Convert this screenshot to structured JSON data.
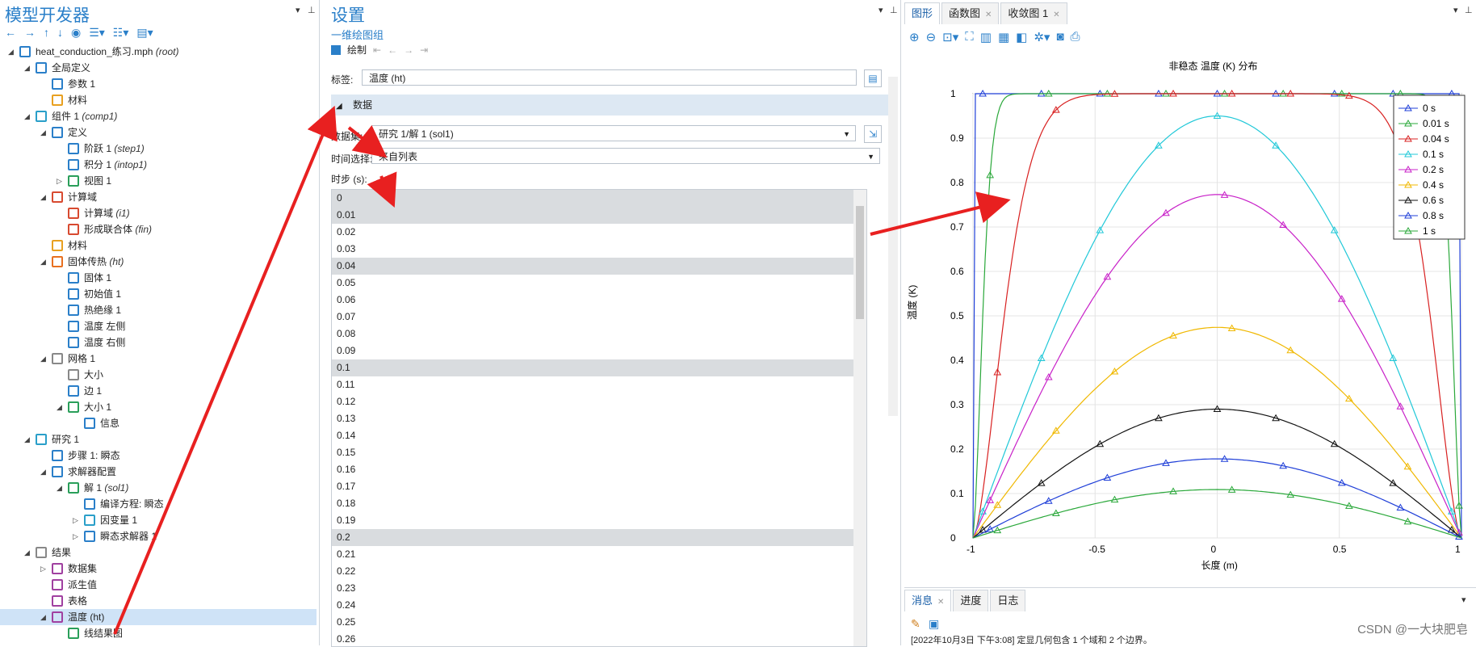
{
  "left": {
    "title": "模型开发器",
    "tree": [
      {
        "label": "heat_conduction_练习.mph",
        "tag": "(root)",
        "indent": 0,
        "toggle": "◢",
        "icon": "#2a7fc9"
      },
      {
        "label": "全局定义",
        "tag": "",
        "indent": 1,
        "toggle": "◢",
        "icon": "#2a7fc9"
      },
      {
        "label": "参数 1",
        "tag": "",
        "indent": 2,
        "toggle": "",
        "icon": "#2a7fc9"
      },
      {
        "label": "材料",
        "tag": "",
        "indent": 2,
        "toggle": "",
        "icon": "#e8a020"
      },
      {
        "label": "组件 1",
        "tag": "(comp1)",
        "indent": 1,
        "toggle": "◢",
        "icon": "#2a9fc9"
      },
      {
        "label": "定义",
        "tag": "",
        "indent": 2,
        "toggle": "◢",
        "icon": "#2a7fc9"
      },
      {
        "label": "阶跃 1",
        "tag": "(step1)",
        "indent": 3,
        "toggle": "",
        "icon": "#2a7fc9"
      },
      {
        "label": "积分 1",
        "tag": "(intop1)",
        "indent": 3,
        "toggle": "",
        "icon": "#2a7fc9"
      },
      {
        "label": "视图 1",
        "tag": "",
        "indent": 3,
        "toggle": "▷",
        "icon": "#2a9f5a"
      },
      {
        "label": "计算域",
        "tag": "",
        "indent": 2,
        "toggle": "◢",
        "icon": "#d84a30"
      },
      {
        "label": "计算域",
        "tag": "(i1)",
        "indent": 3,
        "toggle": "",
        "icon": "#d84a30"
      },
      {
        "label": "形成联合体",
        "tag": "(fin)",
        "indent": 3,
        "toggle": "",
        "icon": "#d84a30"
      },
      {
        "label": "材料",
        "tag": "",
        "indent": 2,
        "toggle": "",
        "icon": "#e8a020"
      },
      {
        "label": "固体传热",
        "tag": "(ht)",
        "indent": 2,
        "toggle": "◢",
        "icon": "#e87020"
      },
      {
        "label": "固体 1",
        "tag": "",
        "indent": 3,
        "toggle": "",
        "icon": "#2a7fc9"
      },
      {
        "label": "初始值 1",
        "tag": "",
        "indent": 3,
        "toggle": "",
        "icon": "#2a7fc9"
      },
      {
        "label": "热绝缘 1",
        "tag": "",
        "indent": 3,
        "toggle": "",
        "icon": "#2a7fc9"
      },
      {
        "label": "温度 左侧",
        "tag": "",
        "indent": 3,
        "toggle": "",
        "icon": "#2a7fc9"
      },
      {
        "label": "温度 右侧",
        "tag": "",
        "indent": 3,
        "toggle": "",
        "icon": "#2a7fc9"
      },
      {
        "label": "网格 1",
        "tag": "",
        "indent": 2,
        "toggle": "◢",
        "icon": "#888888"
      },
      {
        "label": "大小",
        "tag": "",
        "indent": 3,
        "toggle": "",
        "icon": "#888888"
      },
      {
        "label": "边 1",
        "tag": "",
        "indent": 3,
        "toggle": "",
        "icon": "#2a7fc9"
      },
      {
        "label": "大小 1",
        "tag": "",
        "indent": 3,
        "toggle": "◢",
        "icon": "#2a9f5a"
      },
      {
        "label": "信息",
        "tag": "",
        "indent": 4,
        "toggle": "",
        "icon": "#2a7fc9"
      },
      {
        "label": "研究 1",
        "tag": "",
        "indent": 1,
        "toggle": "◢",
        "icon": "#2a9fc9"
      },
      {
        "label": "步骤 1: 瞬态",
        "tag": "",
        "indent": 2,
        "toggle": "",
        "icon": "#2a7fc9"
      },
      {
        "label": "求解器配置",
        "tag": "",
        "indent": 2,
        "toggle": "◢",
        "icon": "#2a7fc9"
      },
      {
        "label": "解 1",
        "tag": "(sol1)",
        "indent": 3,
        "toggle": "◢",
        "icon": "#2a9f5a"
      },
      {
        "label": "编译方程: 瞬态",
        "tag": "",
        "indent": 4,
        "toggle": "",
        "icon": "#2a7fc9"
      },
      {
        "label": "因变量 1",
        "tag": "",
        "indent": 4,
        "toggle": "▷",
        "icon": "#2a9fc9"
      },
      {
        "label": "瞬态求解器 1",
        "tag": "",
        "indent": 4,
        "toggle": "▷",
        "icon": "#2a7fc9"
      },
      {
        "label": "结果",
        "tag": "",
        "indent": 1,
        "toggle": "◢",
        "icon": "#888888"
      },
      {
        "label": "数据集",
        "tag": "",
        "indent": 2,
        "toggle": "▷",
        "icon": "#a040a0"
      },
      {
        "label": "派生值",
        "tag": "",
        "indent": 2,
        "toggle": "",
        "icon": "#a040a0"
      },
      {
        "label": "表格",
        "tag": "",
        "indent": 2,
        "toggle": "",
        "icon": "#a040a0"
      },
      {
        "label": "温度 (ht)",
        "tag": "",
        "indent": 2,
        "toggle": "◢",
        "icon": "#a040a0",
        "selected": true
      },
      {
        "label": "线结果图",
        "tag": "",
        "indent": 3,
        "toggle": "",
        "icon": "#2a9f5a"
      }
    ]
  },
  "mid": {
    "title": "设置",
    "subtitle": "一维绘图组",
    "plot_label": "绘制",
    "label_caption": "标签:",
    "label_value": "温度 (ht)",
    "section": "数据",
    "dataset_caption": "数据集:",
    "dataset_value": "研究 1/解 1 (sol1)",
    "time_caption": "时间选择:",
    "time_value": "来自列表",
    "timestep_caption": "时步 (s):",
    "timesteps": [
      "0",
      "0.01",
      "0.02",
      "0.03",
      "0.04",
      "0.05",
      "0.06",
      "0.07",
      "0.08",
      "0.09",
      "0.1",
      "0.11",
      "0.12",
      "0.13",
      "0.14",
      "0.15",
      "0.16",
      "0.17",
      "0.18",
      "0.19",
      "0.2",
      "0.21",
      "0.22",
      "0.23",
      "0.24",
      "0.25",
      "0.26"
    ],
    "highlighted": [
      "0",
      "0.01",
      "0.04",
      "0.1",
      "0.2"
    ]
  },
  "right": {
    "tabs": [
      {
        "label": "图形",
        "close": ""
      },
      {
        "label": "函数图",
        "close": "✕"
      },
      {
        "label": "收敛图 1",
        "close": "✕"
      }
    ],
    "bottom_tabs": [
      {
        "label": "消息",
        "close": "✕"
      },
      {
        "label": "进度",
        "close": ""
      },
      {
        "label": "日志",
        "close": ""
      }
    ],
    "message_line": "[2022年10月3日 下午3:08] 定显几何包含 1 个域和 2 个边界。",
    "watermark": "CSDN @一大块肥皂"
  },
  "chart_data": {
    "type": "line",
    "title": "非稳态 温度 (K) 分布",
    "xlabel": "长度 (m)",
    "ylabel": "温度 (K)",
    "xlim": [
      -1,
      1
    ],
    "ylim": [
      0,
      1
    ],
    "xticks": [
      "-1",
      "-0.5",
      "0",
      "0.5",
      "1"
    ],
    "yticks": [
      "0",
      "0.1",
      "0.2",
      "0.3",
      "0.4",
      "0.5",
      "0.6",
      "0.7",
      "0.8",
      "0.9",
      "1"
    ],
    "legend_position": "top-right",
    "series": [
      {
        "name": "0 s",
        "color": "#1f3fd8",
        "peak": 1.0
      },
      {
        "name": "0.01 s",
        "color": "#2aa83a",
        "peak": 1.0
      },
      {
        "name": "0.04 s",
        "color": "#d82020",
        "peak": 1.0
      },
      {
        "name": "0.1 s",
        "color": "#20c8d8",
        "peak": 0.95
      },
      {
        "name": "0.2 s",
        "color": "#c820c8",
        "peak": 0.773
      },
      {
        "name": "0.4 s",
        "color": "#f0b800",
        "peak": 0.474
      },
      {
        "name": "0.6 s",
        "color": "#111111",
        "peak": 0.29
      },
      {
        "name": "0.8 s",
        "color": "#1f3fd8",
        "peak": 0.178
      },
      {
        "name": "1 s",
        "color": "#2aa83a",
        "peak": 0.109
      }
    ]
  }
}
